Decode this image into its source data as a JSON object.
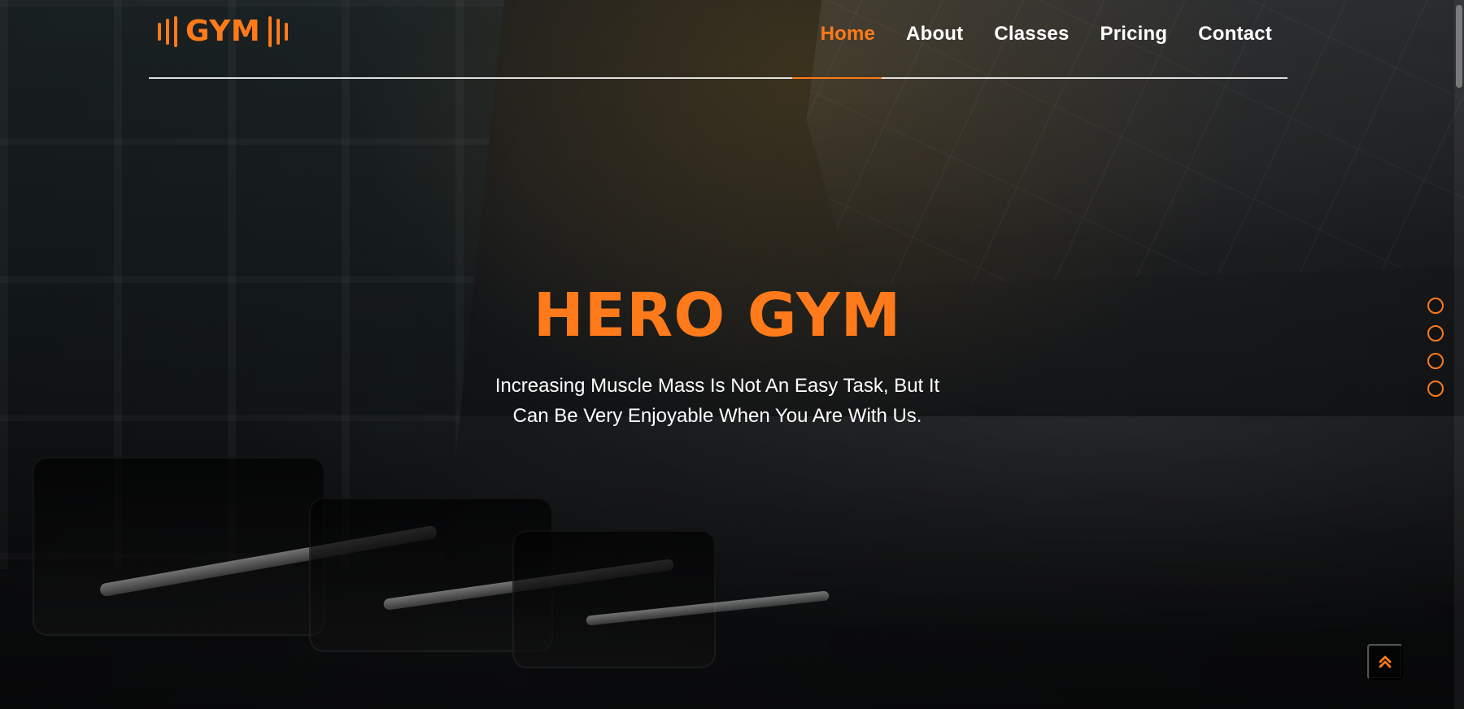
{
  "brand": {
    "logo_text": "GYM",
    "accent_color": "#ff7a1a",
    "icon_left": "bars-icon",
    "icon_right": "bars-icon"
  },
  "nav": {
    "items": [
      {
        "label": "Home",
        "active": true
      },
      {
        "label": "About",
        "active": false
      },
      {
        "label": "Classes",
        "active": false
      },
      {
        "label": "Pricing",
        "active": false
      },
      {
        "label": "Contact",
        "active": false
      }
    ]
  },
  "hero": {
    "title": "HERO GYM",
    "subtitle_line_1": "Increasing Muscle Mass Is Not An Easy Task, But It",
    "subtitle_line_2": "Can Be Very Enjoyable When You Are With Us."
  },
  "ui": {
    "scroll_to_top_icon": "double-chevron-up-icon",
    "section_dots_count": 4
  }
}
